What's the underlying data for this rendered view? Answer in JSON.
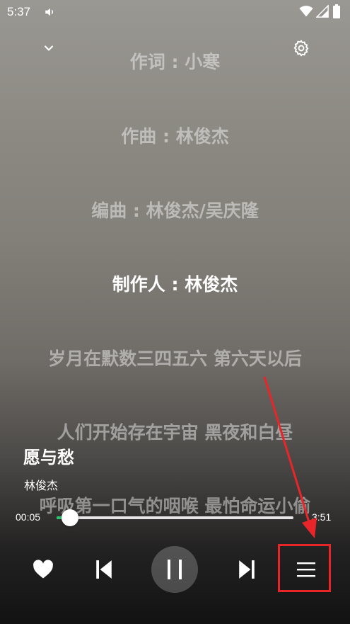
{
  "status_bar": {
    "time": "5:37"
  },
  "lyrics": [
    {
      "text": "作词 : 小寒",
      "active": false
    },
    {
      "text": "作曲 : 林俊杰",
      "active": false
    },
    {
      "text": "编曲 : 林俊杰/吴庆隆",
      "active": false
    },
    {
      "text": "制作人 : 林俊杰",
      "active": true
    },
    {
      "text": "岁月在默数三四五六 第六天以后",
      "active": false
    },
    {
      "text": "人们开始存在宇宙 黑夜和白昼",
      "active": false
    },
    {
      "text": "呼吸第一口气的咽喉 最怕命运小偷",
      "active": false
    }
  ],
  "song": {
    "title": "愿与愁",
    "artist": "林俊杰"
  },
  "player": {
    "current_time": "00:05",
    "total_time": "3:51",
    "progress_fraction": 0.056
  },
  "colors": {
    "accent": "#28c76f",
    "highlight": "#e8262a"
  },
  "icons": {
    "collapse": "chevron-down-icon",
    "settings": "gear-icon",
    "like": "heart-icon",
    "prev": "skip-previous-icon",
    "play": "pause-icon",
    "next": "skip-next-icon",
    "playlist": "menu-icon"
  }
}
